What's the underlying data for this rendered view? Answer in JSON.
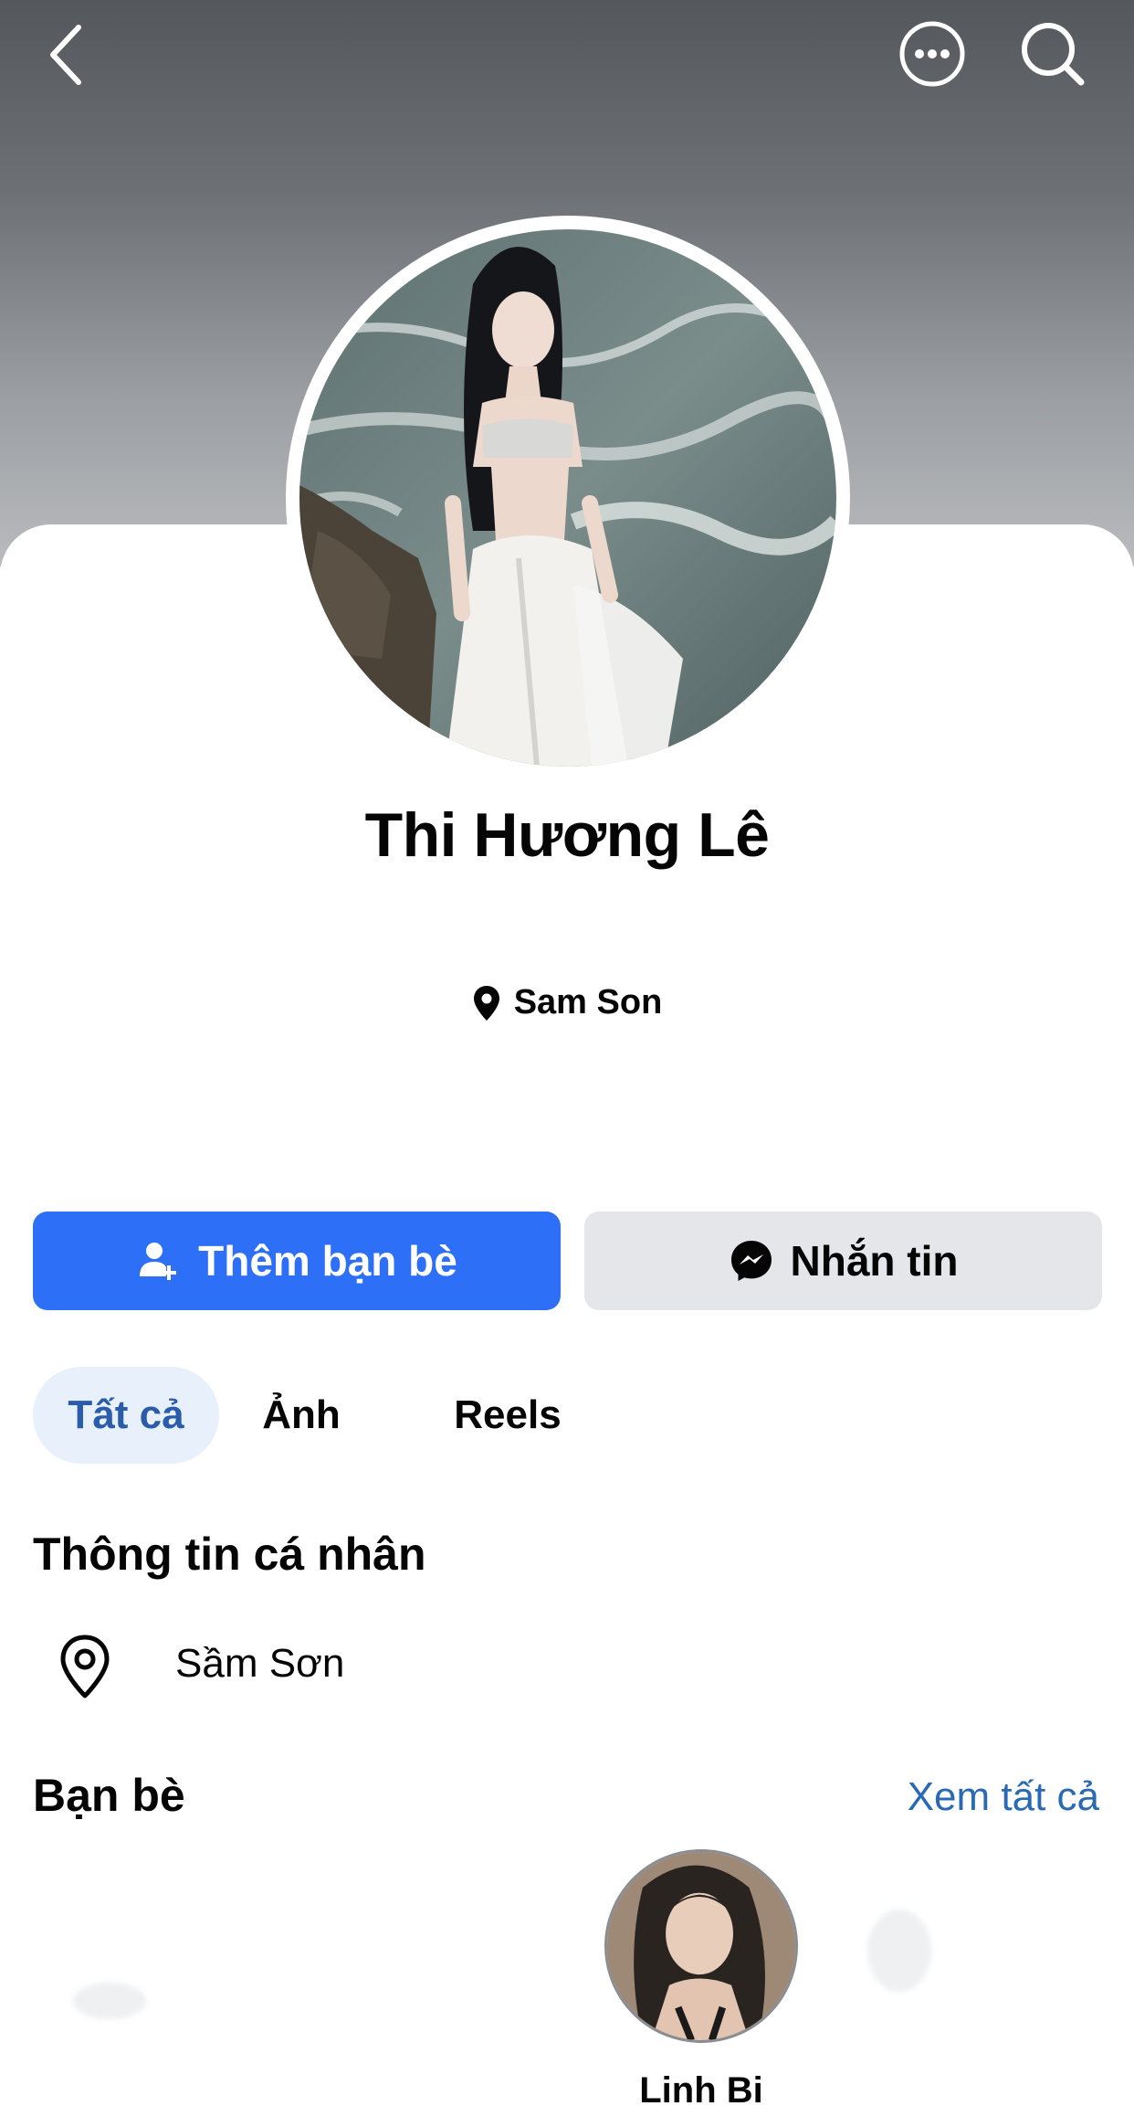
{
  "header": {
    "back_icon": "chevron-left-icon",
    "more_icon": "more-horizontal-icon",
    "search_icon": "search-icon"
  },
  "profile": {
    "name": "Thi Hương Lê",
    "location": "Sam Son",
    "location_icon": "map-pin-icon"
  },
  "actions": {
    "add_friend_label": "Thêm bạn bè",
    "add_friend_icon": "add-person-icon",
    "message_label": "Nhắn tin",
    "message_icon": "messenger-icon"
  },
  "tabs": [
    {
      "label": "Tất cả",
      "active": true
    },
    {
      "label": "Ảnh",
      "active": false
    },
    {
      "label": "Reels",
      "active": false
    }
  ],
  "personal_info": {
    "title": "Thông tin cá nhân",
    "items": [
      {
        "icon": "location-pin-outline-icon",
        "text": "Sầm Sơn"
      }
    ]
  },
  "friends": {
    "title": "Bạn bè",
    "see_all_label": "Xem tất cả",
    "items": [
      {
        "name": "Linh Bi"
      }
    ]
  },
  "colors": {
    "primary_button": "#2d6ff7",
    "secondary_button": "#e4e6ea",
    "active_tab_bg": "#e7f0fb",
    "active_tab_text": "#2a5cab",
    "link": "#2a69b4"
  }
}
